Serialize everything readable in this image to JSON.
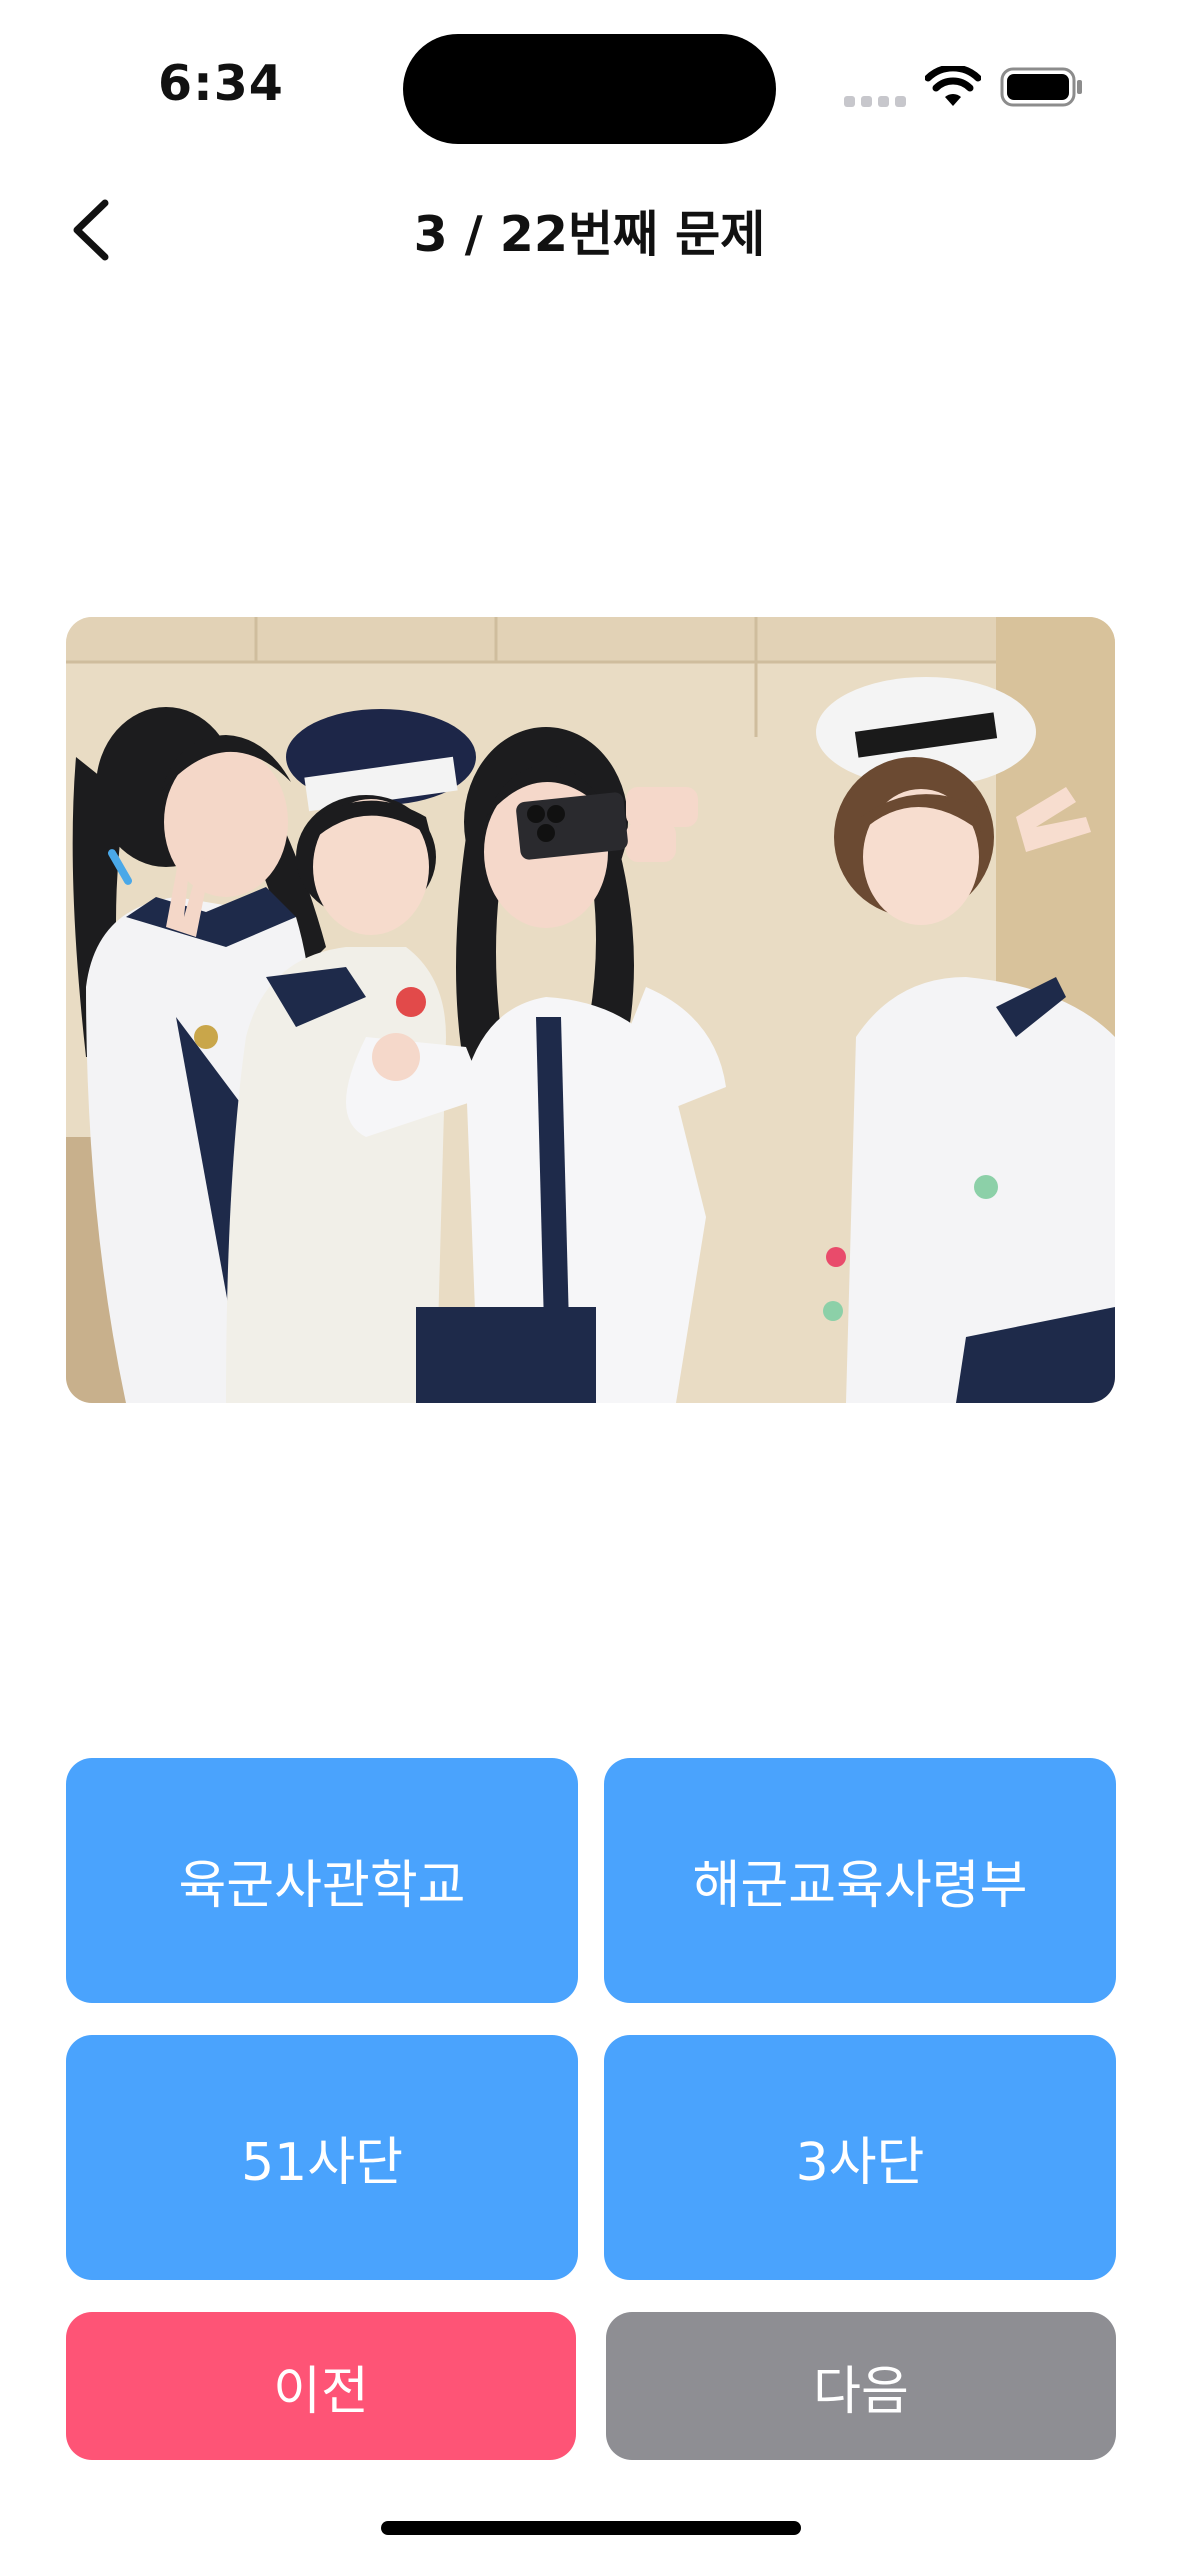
{
  "status_bar": {
    "time": "6:34"
  },
  "header": {
    "title": "3 / 22번째 문제",
    "back_icon": "chevron-left-icon"
  },
  "quiz": {
    "image_alt": "photo-four-people-sailor-uniforms",
    "options": [
      {
        "label": "육군사관학교"
      },
      {
        "label": "해군교육사령부"
      },
      {
        "label": "51사단"
      },
      {
        "label": "3사단"
      }
    ]
  },
  "navigation": {
    "prev_label": "이전",
    "next_label": "다음"
  },
  "colors": {
    "option_blue": "#4aa3fd",
    "prev_pink": "#fe5476",
    "next_gray": "#8e8e93"
  }
}
